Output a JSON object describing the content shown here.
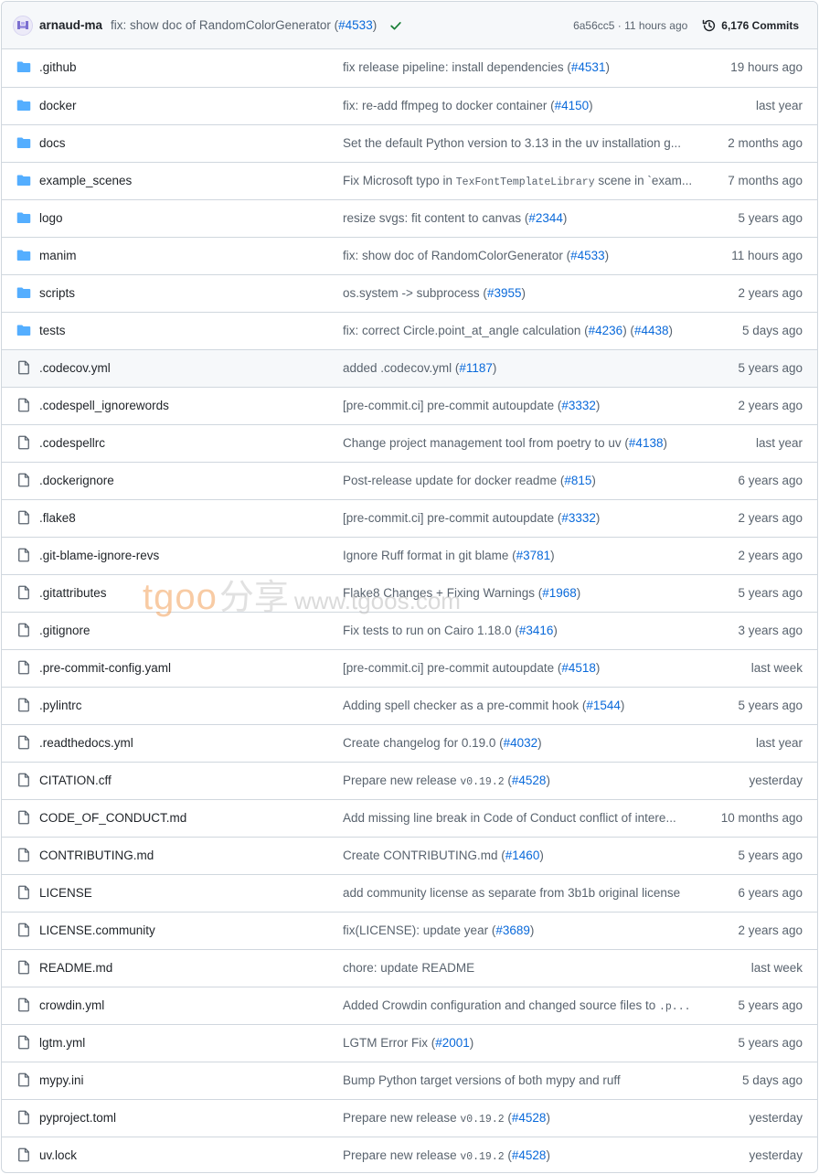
{
  "header": {
    "author": "arnaud-ma",
    "commit_message": "fix: show doc of RandomColorGenerator",
    "commit_link": "#4533",
    "sha": "6a56cc5",
    "separator": " · ",
    "time": "11 hours ago",
    "commits_count": "6,176 Commits"
  },
  "colors": {
    "link": "#0969da",
    "folder": "#54aeff",
    "check": "#1a7f37",
    "muted": "#59636e",
    "border": "#d0d7de"
  },
  "files": [
    {
      "type": "folder",
      "name": ".github",
      "msg": "fix release pipeline: install dependencies (",
      "links": [
        "#4531"
      ],
      "suffix": ")",
      "age": "19 hours ago"
    },
    {
      "type": "folder",
      "name": "docker",
      "msg": "fix: re-add ffmpeg to docker container (",
      "links": [
        "#4150"
      ],
      "suffix": ")",
      "age": "last year"
    },
    {
      "type": "folder",
      "name": "docs",
      "msg": "Set the default Python version to 3.13 in the uv installation g...",
      "age": "2 months ago"
    },
    {
      "type": "folder",
      "name": "example_scenes",
      "msg": "Fix Microsoft typo in ",
      "code": "TexFontTemplateLibrary",
      "msg_after": " scene in `exam...",
      "age": "7 months ago"
    },
    {
      "type": "folder",
      "name": "logo",
      "msg": "resize svgs: fit content to canvas (",
      "links": [
        "#2344"
      ],
      "suffix": ")",
      "age": "5 years ago"
    },
    {
      "type": "folder",
      "name": "manim",
      "msg": "fix: show doc of RandomColorGenerator (",
      "links": [
        "#4533"
      ],
      "suffix": ")",
      "age": "11 hours ago"
    },
    {
      "type": "folder",
      "name": "scripts",
      "msg": "os.system -> subprocess (",
      "links": [
        "#3955"
      ],
      "suffix": ")",
      "age": "2 years ago"
    },
    {
      "type": "folder",
      "name": "tests",
      "msg": "fix: correct Circle.point_at_angle calculation (",
      "links": [
        "#4236",
        "#4438"
      ],
      "suffix": ")",
      "age": "5 days ago"
    },
    {
      "type": "file",
      "name": ".codecov.yml",
      "msg": "added .codecov.yml (",
      "links": [
        "#1187"
      ],
      "suffix": ")",
      "age": "5 years ago",
      "hover": true
    },
    {
      "type": "file",
      "name": ".codespell_ignorewords",
      "msg": "[pre-commit.ci] pre-commit autoupdate (",
      "links": [
        "#3332"
      ],
      "suffix": ")",
      "age": "2 years ago"
    },
    {
      "type": "file",
      "name": ".codespellrc",
      "msg": "Change project management tool from poetry to uv (",
      "links": [
        "#4138"
      ],
      "suffix": ")",
      "age": "last year"
    },
    {
      "type": "file",
      "name": ".dockerignore",
      "msg": "Post-release update for docker readme (",
      "links": [
        "#815"
      ],
      "suffix": ")",
      "age": "6 years ago"
    },
    {
      "type": "file",
      "name": ".flake8",
      "msg": "[pre-commit.ci] pre-commit autoupdate (",
      "links": [
        "#3332"
      ],
      "suffix": ")",
      "age": "2 years ago"
    },
    {
      "type": "file",
      "name": ".git-blame-ignore-revs",
      "msg": "Ignore Ruff format in git blame (",
      "links": [
        "#3781"
      ],
      "suffix": ")",
      "age": "2 years ago"
    },
    {
      "type": "file",
      "name": ".gitattributes",
      "msg": "Flake8 Changes + Fixing Warnings (",
      "links": [
        "#1968"
      ],
      "suffix": ")",
      "age": "5 years ago"
    },
    {
      "type": "file",
      "name": ".gitignore",
      "msg": "Fix tests to run on Cairo 1.18.0 (",
      "links": [
        "#3416"
      ],
      "suffix": ")",
      "age": "3 years ago"
    },
    {
      "type": "file",
      "name": ".pre-commit-config.yaml",
      "msg": "[pre-commit.ci] pre-commit autoupdate (",
      "links": [
        "#4518"
      ],
      "suffix": ")",
      "age": "last week"
    },
    {
      "type": "file",
      "name": ".pylintrc",
      "msg": "Adding spell checker as a pre-commit hook (",
      "links": [
        "#1544"
      ],
      "suffix": ")",
      "age": "5 years ago"
    },
    {
      "type": "file",
      "name": ".readthedocs.yml",
      "msg": "Create changelog for 0.19.0 (",
      "links": [
        "#4032"
      ],
      "suffix": ")",
      "age": "last year"
    },
    {
      "type": "file",
      "name": "CITATION.cff",
      "msg": "Prepare new release ",
      "code": "v0.19.2",
      "msg_after": " (",
      "links": [
        "#4528"
      ],
      "suffix": ")",
      "age": "yesterday"
    },
    {
      "type": "file",
      "name": "CODE_OF_CONDUCT.md",
      "msg": "Add missing line break in Code of Conduct conflict of intere...",
      "age": "10 months ago"
    },
    {
      "type": "file",
      "name": "CONTRIBUTING.md",
      "msg": "Create CONTRIBUTING.md (",
      "links": [
        "#1460"
      ],
      "suffix": ")",
      "age": "5 years ago"
    },
    {
      "type": "file",
      "name": "LICENSE",
      "msg": "add community license as separate from 3b1b original license",
      "age": "6 years ago"
    },
    {
      "type": "file",
      "name": "LICENSE.community",
      "msg": "fix(LICENSE): update year (",
      "links": [
        "#3689"
      ],
      "suffix": ")",
      "age": "2 years ago"
    },
    {
      "type": "file",
      "name": "README.md",
      "msg": "chore: update README",
      "age": "last week"
    },
    {
      "type": "file",
      "name": "crowdin.yml",
      "msg": "Added Crowdin configuration and changed source files to ",
      "code": ".p...",
      "age": "5 years ago"
    },
    {
      "type": "file",
      "name": "lgtm.yml",
      "msg": "LGTM Error Fix (",
      "links": [
        "#2001"
      ],
      "suffix": ")",
      "age": "5 years ago"
    },
    {
      "type": "file",
      "name": "mypy.ini",
      "msg": "Bump Python target versions of both mypy and ruff",
      "age": "5 days ago"
    },
    {
      "type": "file",
      "name": "pyproject.toml",
      "msg": "Prepare new release ",
      "code": "v0.19.2",
      "msg_after": " (",
      "links": [
        "#4528"
      ],
      "suffix": ")",
      "age": "yesterday"
    },
    {
      "type": "file",
      "name": "uv.lock",
      "msg": "Prepare new release ",
      "code": "v0.19.2",
      "msg_after": " (",
      "links": [
        "#4528"
      ],
      "suffix": ")",
      "age": "yesterday"
    }
  ],
  "watermark": {
    "brand": "tgoo",
    "cn": "分享",
    "url": "www.tgoos.com"
  }
}
